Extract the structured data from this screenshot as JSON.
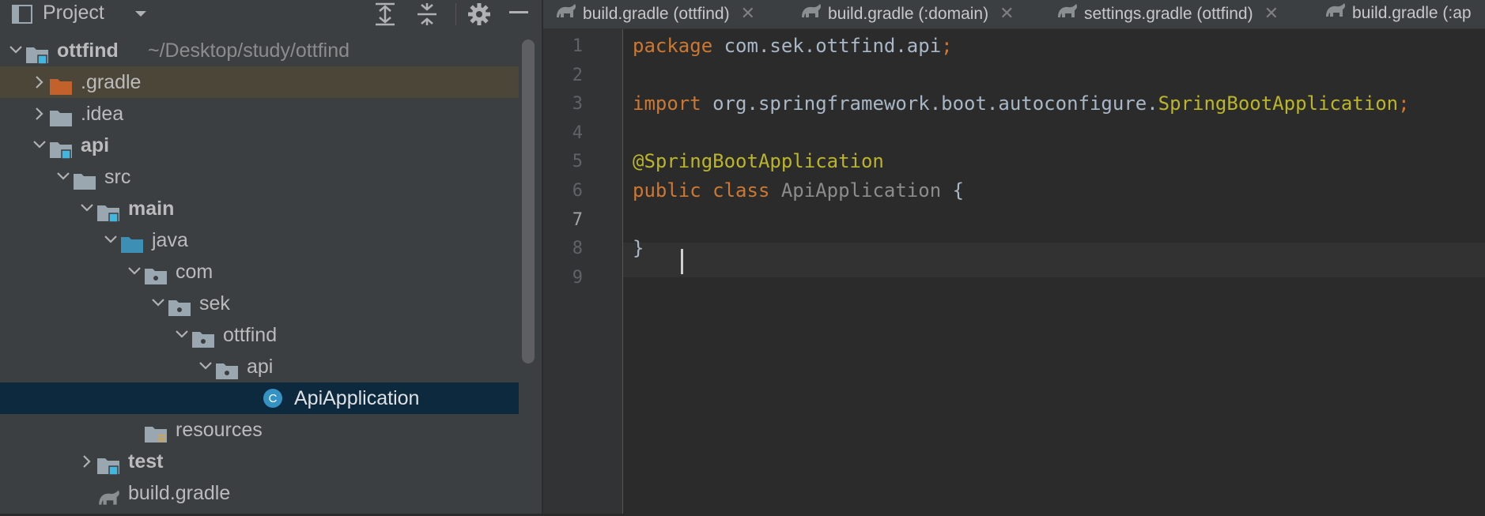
{
  "project_panel": {
    "title": "Project",
    "tree": [
      {
        "label": "ottfind",
        "path": "~/Desktop/study/ottfind",
        "depth": 0,
        "state": "expanded",
        "icon": "module-folder-icon",
        "bold": true
      },
      {
        "label": ".gradle",
        "depth": 1,
        "state": "collapsed",
        "icon": "excluded-folder-icon",
        "highlight": true
      },
      {
        "label": ".idea",
        "depth": 1,
        "state": "collapsed",
        "icon": "folder-icon"
      },
      {
        "label": "api",
        "depth": 1,
        "state": "expanded",
        "icon": "module-folder-icon",
        "bold": true
      },
      {
        "label": "src",
        "depth": 2,
        "state": "expanded",
        "icon": "folder-icon"
      },
      {
        "label": "main",
        "depth": 3,
        "state": "expanded",
        "icon": "module-folder-icon",
        "bold": true
      },
      {
        "label": "java",
        "depth": 4,
        "state": "expanded",
        "icon": "source-folder-icon"
      },
      {
        "label": "com",
        "depth": 5,
        "state": "expanded",
        "icon": "package-icon"
      },
      {
        "label": "sek",
        "depth": 6,
        "state": "expanded",
        "icon": "package-icon"
      },
      {
        "label": "ottfind",
        "depth": 7,
        "state": "expanded",
        "icon": "package-icon"
      },
      {
        "label": "api",
        "depth": 8,
        "state": "expanded",
        "icon": "package-icon"
      },
      {
        "label": "ApiApplication",
        "depth": 10,
        "state": "leaf",
        "icon": "java-class-icon",
        "selected": true
      },
      {
        "label": "resources",
        "depth": 5,
        "state": "leaf",
        "icon": "resources-folder-icon"
      },
      {
        "label": "test",
        "depth": 3,
        "state": "collapsed",
        "icon": "module-folder-icon",
        "bold": true
      },
      {
        "label": "build.gradle",
        "depth": 3,
        "state": "leaf",
        "icon": "gradle-icon"
      }
    ]
  },
  "tabs": [
    {
      "label": "build.gradle (ottfind)"
    },
    {
      "label": "build.gradle (:domain)"
    },
    {
      "label": "settings.gradle (ottfind)"
    },
    {
      "label": "build.gradle (:ap"
    }
  ],
  "editor": {
    "line_numbers": [
      "1",
      "2",
      "3",
      "4",
      "5",
      "6",
      "7",
      "8",
      "9"
    ],
    "current_line": "7",
    "lines": {
      "l1_kw": "package",
      "l1_rest": " com.sek.ottfind.api",
      "l1_semi": ";",
      "l3_kw": "import",
      "l3_pkg": " org.springframework.boot.autoconfigure.",
      "l3_cls": "SpringBootApplication",
      "l3_semi": ";",
      "l5_ann": "@SpringBootApplication",
      "l6_kw1": "public",
      "l6_kw2": " class",
      "l6_cls": " ApiApplication",
      "l6_brace": " {",
      "l8_brace": "}"
    }
  },
  "colors": {
    "keyword": "#cc7832",
    "annotation": "#bbb529",
    "selection": "#0d293e",
    "panel": "#3c3f41",
    "editor_bg": "#2b2b2b"
  }
}
